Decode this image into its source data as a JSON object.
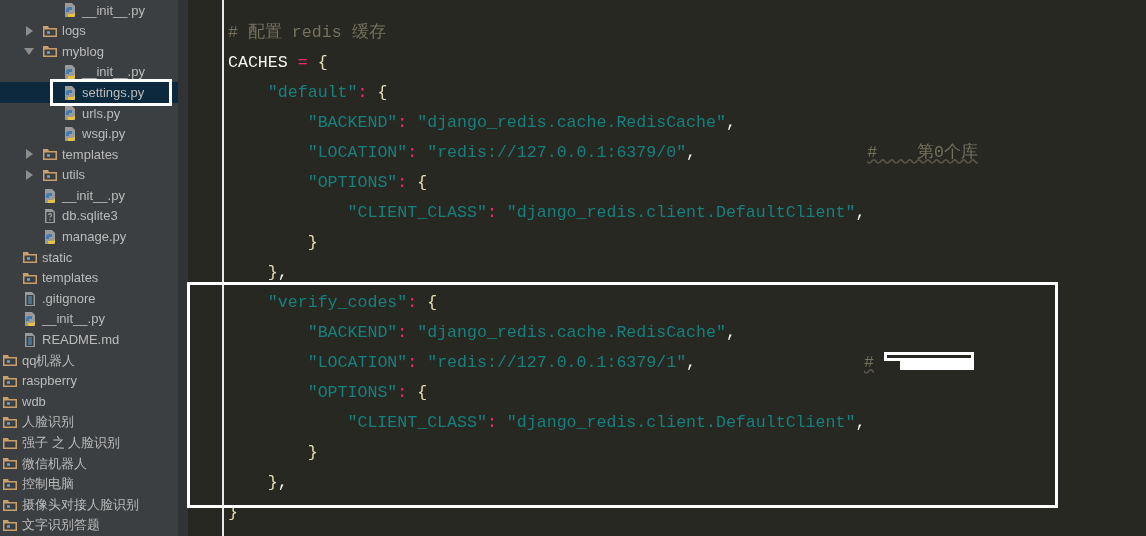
{
  "project_tree": [
    {
      "children": [
        {
          "children": [
            {
              "children": [
                {
                  "label": "__init__.py",
                  "kind": "python",
                  "selected": false
                }
              ]
            },
            {
              "label": "logs",
              "kind": "package",
              "expanded": false,
              "selected": false
            },
            {
              "label": "myblog",
              "kind": "package",
              "expanded": true,
              "selected": false,
              "children": [
                {
                  "label": "__init__.py",
                  "kind": "python",
                  "selected": false
                },
                {
                  "label": "settings.py",
                  "kind": "python",
                  "selected": true
                },
                {
                  "label": "urls.py",
                  "kind": "python",
                  "selected": false
                },
                {
                  "label": "wsgi.py",
                  "kind": "python",
                  "selected": false
                }
              ]
            },
            {
              "label": "templates",
              "kind": "package",
              "expanded": false,
              "selected": false
            },
            {
              "label": "utils",
              "kind": "package",
              "expanded": false,
              "selected": false
            },
            {
              "label": "__init__.py",
              "kind": "python",
              "selected": false
            },
            {
              "label": "db.sqlite3",
              "kind": "unknown",
              "selected": false
            },
            {
              "label": "manage.py",
              "kind": "python",
              "selected": false
            }
          ]
        },
        {
          "label": "static",
          "kind": "package",
          "selected": false
        },
        {
          "label": "templates",
          "kind": "package",
          "selected": false
        },
        {
          "label": ".gitignore",
          "kind": "text",
          "selected": false
        },
        {
          "label": "__init__.py",
          "kind": "python",
          "selected": false
        },
        {
          "label": "README.md",
          "kind": "text",
          "selected": false
        }
      ]
    },
    {
      "label": "qq机器人",
      "kind": "package",
      "selected": false
    },
    {
      "label": "raspberry",
      "kind": "package",
      "selected": false
    },
    {
      "label": "wdb",
      "kind": "package",
      "selected": false
    },
    {
      "label": "人脸识别",
      "kind": "package",
      "selected": false
    },
    {
      "label": "强子 之 人脸识别",
      "kind": "folder",
      "selected": false
    },
    {
      "label": "微信机器人",
      "kind": "package",
      "selected": false
    },
    {
      "label": "控制电脑",
      "kind": "package",
      "selected": false
    },
    {
      "label": "摄像头对接人脸识别",
      "kind": "package",
      "selected": false
    },
    {
      "label": "文字识别答题",
      "kind": "package",
      "selected": false
    }
  ],
  "editor": {
    "lines": [
      {
        "tokens": [
          {
            "t": "# 配置 redis 缓存",
            "kind": "comment"
          }
        ]
      },
      {
        "tokens": [
          {
            "t": "CACHES ",
            "kind": "name"
          },
          {
            "t": "=",
            "kind": "operator"
          },
          {
            "t": " {",
            "kind": "brace"
          }
        ]
      },
      {
        "tokens": [
          {
            "t": "    \"default\"",
            "kind": "string"
          },
          {
            "t": ":",
            "kind": "operator"
          },
          {
            "t": " {",
            "kind": "brace"
          }
        ]
      },
      {
        "tokens": [
          {
            "t": "        \"BACKEND\"",
            "kind": "string"
          },
          {
            "t": ": ",
            "kind": "operator"
          },
          {
            "t": "\"django_redis.cache.RedisCache\"",
            "kind": "string"
          },
          {
            "t": ",",
            "kind": "name"
          }
        ]
      },
      {
        "tokens": [
          {
            "t": "        \"LOCATION\"",
            "kind": "string"
          },
          {
            "t": ": ",
            "kind": "operator"
          },
          {
            "t": "\"redis://127.0.0.1:6379/0\"",
            "kind": "string"
          },
          {
            "t": ",",
            "kind": "name"
          }
        ],
        "comment": "#    第0个库"
      },
      {
        "tokens": [
          {
            "t": "        \"OPTIONS\"",
            "kind": "string"
          },
          {
            "t": ": ",
            "kind": "operator"
          },
          {
            "t": "{",
            "kind": "brace"
          }
        ]
      },
      {
        "tokens": [
          {
            "t": "            \"CLIENT_CLASS\"",
            "kind": "string"
          },
          {
            "t": ": ",
            "kind": "operator"
          },
          {
            "t": "\"django_redis.client.DefaultClient\"",
            "kind": "string"
          },
          {
            "t": ",",
            "kind": "name"
          }
        ]
      },
      {
        "tokens": [
          {
            "t": "        }",
            "kind": "brace"
          }
        ]
      },
      {
        "tokens": [
          {
            "t": "    }",
            "kind": "brace"
          },
          {
            "t": ",",
            "kind": "name"
          }
        ]
      },
      {
        "tokens": [
          {
            "t": "    \"verify_codes\"",
            "kind": "string"
          },
          {
            "t": ":",
            "kind": "operator"
          },
          {
            "t": " {",
            "kind": "brace"
          }
        ]
      },
      {
        "tokens": [
          {
            "t": "        \"BACKEND\"",
            "kind": "string"
          },
          {
            "t": ": ",
            "kind": "operator"
          },
          {
            "t": "\"django_redis.cache.RedisCache\"",
            "kind": "string"
          },
          {
            "t": ",",
            "kind": "name"
          }
        ]
      },
      {
        "tokens": [
          {
            "t": "        \"LOCATION\"",
            "kind": "string"
          },
          {
            "t": ": ",
            "kind": "operator"
          },
          {
            "t": "\"redis://127.0.0.1:6379/1\"",
            "kind": "string"
          },
          {
            "t": ",",
            "kind": "name"
          }
        ],
        "comment": "#"
      },
      {
        "tokens": [
          {
            "t": "        \"OPTIONS\"",
            "kind": "string"
          },
          {
            "t": ": ",
            "kind": "operator"
          },
          {
            "t": "{",
            "kind": "brace"
          }
        ]
      },
      {
        "tokens": [
          {
            "t": "            \"CLIENT_CLASS\"",
            "kind": "string"
          },
          {
            "t": ": ",
            "kind": "operator"
          },
          {
            "t": "\"django_redis.client.DefaultClient\"",
            "kind": "string"
          },
          {
            "t": ",",
            "kind": "name"
          }
        ]
      },
      {
        "tokens": [
          {
            "t": "        }",
            "kind": "brace"
          }
        ]
      },
      {
        "tokens": [
          {
            "t": "    }",
            "kind": "brace"
          },
          {
            "t": ",",
            "kind": "name"
          }
        ]
      },
      {
        "tokens": [
          {
            "t": "}",
            "kind": "brace"
          }
        ]
      }
    ]
  }
}
